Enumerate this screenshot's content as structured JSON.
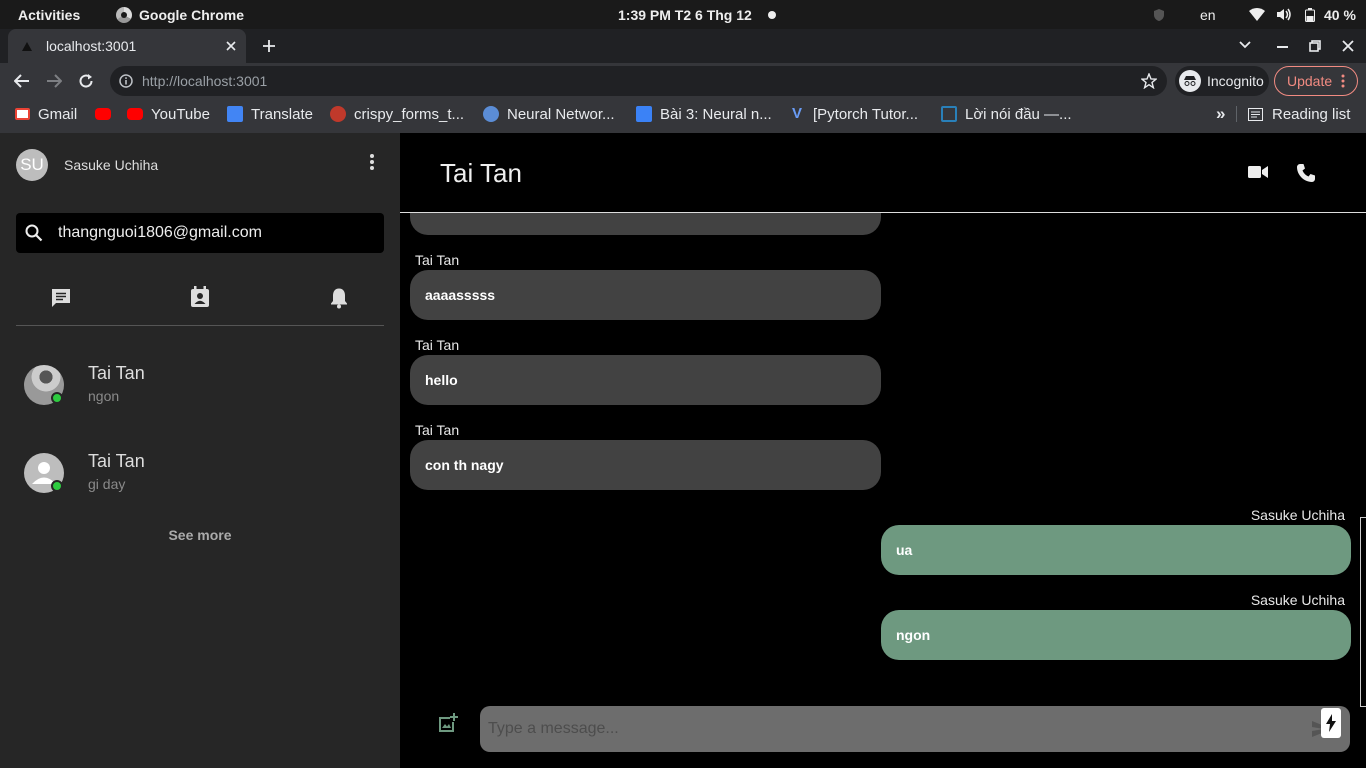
{
  "gnome": {
    "activities": "Activities",
    "app_name": "Google Chrome",
    "clock": "1:39 PM  T2 6 Thg 12",
    "lang": "en",
    "battery": "40 %"
  },
  "browser": {
    "tab_title": "localhost:3001",
    "url_prefix": "http://",
    "url_host": "localhost:3001",
    "incognito": "Incognito",
    "update": "Update",
    "bookmarks": [
      {
        "label": "Gmail",
        "color": "#ea4335"
      },
      {
        "label": "",
        "color": "#ff0000"
      },
      {
        "label": "YouTube",
        "color": "#ff0000"
      },
      {
        "label": "Translate",
        "color": "#4285f4"
      },
      {
        "label": "crispy_forms_t...",
        "color": "#c0392b"
      },
      {
        "label": "Neural Networ...",
        "color": "#5b8dd6"
      },
      {
        "label": "Bài 3: Neural n...",
        "color": "#3b82f6"
      },
      {
        "label": "[Pytorch Tutor...",
        "color": "#3b6fd8"
      },
      {
        "label": "Lời nói đầu —...",
        "color": "#2980b9"
      }
    ],
    "more_bookmarks": "»",
    "reading_list": "Reading list"
  },
  "sidebar": {
    "user_initials": "SU",
    "user_name": "Sasuke Uchiha",
    "search_value": "thangnguoi1806@gmail.com",
    "tabs": [
      "chat-icon",
      "contacts-icon",
      "bell-icon"
    ],
    "conversations": [
      {
        "name": "Tai Tan",
        "last_message": "ngon",
        "online": true
      },
      {
        "name": "Tai Tan",
        "last_message": "gi day",
        "online": true
      }
    ],
    "see_more": "See more"
  },
  "chat": {
    "contact_name": "Tai Tan",
    "messages": [
      {
        "sender": "Tai Tan",
        "text": "aaaasssss",
        "outgoing": false
      },
      {
        "sender": "Tai Tan",
        "text": "hello",
        "outgoing": false
      },
      {
        "sender": "Tai Tan",
        "text": "con th nagy",
        "outgoing": false
      },
      {
        "sender": "Sasuke Uchiha",
        "text": "ua",
        "outgoing": true
      },
      {
        "sender": "Sasuke Uchiha",
        "text": "ngon",
        "outgoing": true
      }
    ],
    "input_placeholder": "Type a message..."
  },
  "colors": {
    "outgoing_bubble": "#6e9980",
    "incoming_bubble": "#424242",
    "online": "#2ecc40"
  }
}
